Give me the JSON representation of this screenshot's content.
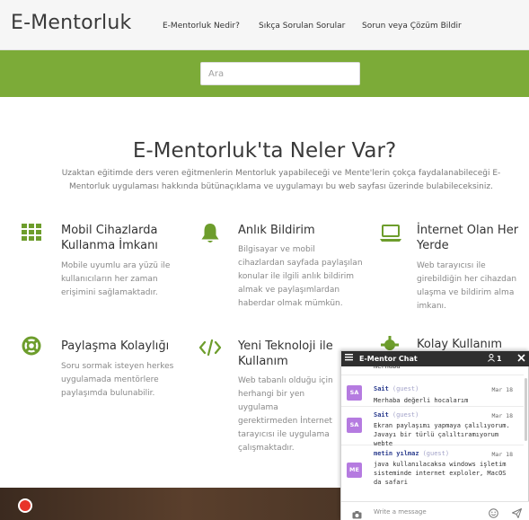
{
  "header": {
    "logo": "E-Mentorluk",
    "nav": [
      {
        "label": "E-Mentorluk Nedir?"
      },
      {
        "label": "Sıkça Sorulan Sorular"
      },
      {
        "label": "Sorun veya Çözüm Bildir"
      }
    ]
  },
  "search": {
    "placeholder": "Ara"
  },
  "section": {
    "title": "E-Mentorluk'ta Neler Var?",
    "subtitle": "Uzaktan eğitimde ders veren eğitmenlerin Mentorluk yapabileceği ve Mente'lerin çokça faydalanabileceği E-Mentorluk uygulaması hakkında bütünaçıklama ve uygulamayı bu web sayfası üzerinde bulabileceksiniz."
  },
  "features": [
    {
      "icon": "grid-icon",
      "title": "Mobil Cihazlarda Kullanma İmkanı",
      "desc": "Mobile uyumlu ara yüzü ile kullanıcıların her zaman erişimini sağlamaktadır."
    },
    {
      "icon": "bell-icon",
      "title": "Anlık Bildirim",
      "desc": "Bilgisayar ve mobil cihazlardan sayfada paylaşılan konular ile ilgili anlık bildirim almak ve paylaşımlardan haberdar olmak mümkün."
    },
    {
      "icon": "laptop-icon",
      "title": "İnternet Olan Her Yerde",
      "desc": "Web tarayıcısı ile girebildiğin her cihazdan ulaşma ve bildirim alma imkanı."
    },
    {
      "icon": "lifebuoy-icon",
      "title": "Paylaşma Kolaylığı",
      "desc": "Soru sormak isteyen herkes uygulamada mentörlere paylaşımda bulunabilir."
    },
    {
      "icon": "code-icon",
      "title": "Yeni Teknoloji ile Kullanım",
      "desc": "Web tabanlı olduğu için herhangi bir yen uygulama gerektirmeden İnternet tarayıcısı ile uygulama çalışmaktadır."
    },
    {
      "icon": "gear-icon",
      "title": "Kolay Kullanım",
      "desc": ""
    }
  ],
  "colors": {
    "accent_green": "#7cab38",
    "icon_green": "#6d9d2c",
    "chat_header": "#2f2f2f",
    "avatar_purple": "#b57be0",
    "help_red": "#e8342a"
  },
  "chat": {
    "title": "E-Mentor Chat",
    "user_count": "1",
    "partial_text": "merhaba",
    "messages": [
      {
        "initials": "SA",
        "name": "Sait",
        "tag": "(guest)",
        "date": "Mar 18",
        "text": "Merhaba değerli hocalarım"
      },
      {
        "initials": "SA",
        "name": "Sait",
        "tag": "(guest)",
        "date": "Mar 18",
        "text": "Ekran paylaşımı yapmaya çalılıyorum. Javayı bir türlü çalıltıramıyorum webte"
      },
      {
        "initials": "ME",
        "name": "metin yılmaz",
        "tag": "(guest)",
        "date": "Mar 18",
        "text": "java kullanılacaksa windows işletim sisteminde internet exploler, MacOS da safari"
      }
    ],
    "input_placeholder": "Write a message"
  }
}
